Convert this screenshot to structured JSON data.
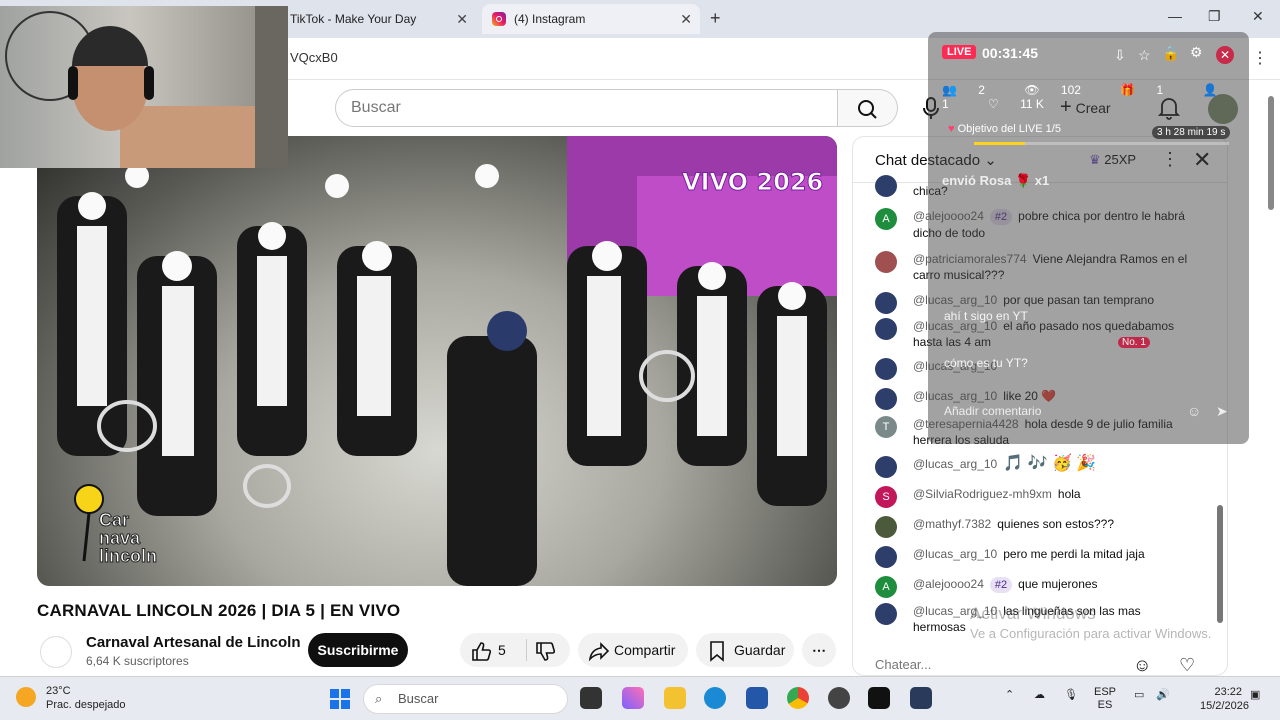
{
  "browser": {
    "tabs": [
      {
        "label": "TikTok - Make Your Day"
      },
      {
        "label": "(4) Instagram"
      }
    ],
    "url_fragment": "VQcxB0"
  },
  "youtube": {
    "search_placeholder": "Buscar",
    "create_label": "Crear",
    "video_overlay_text": "VIVO 2026",
    "logo_text": "Car nava lincoln",
    "title": "CARNAVAL LINCOLN 2026 | DIA 5 | EN VIVO",
    "channel_name": "Carnaval Artesanal de Lincoln",
    "subscribers": "6,64 K suscriptores",
    "subscribe_label": "Suscribirme",
    "like_count": "5",
    "share_label": "Compartir",
    "save_label": "Guardar"
  },
  "chat": {
    "title": "Chat destacado",
    "xp": "25XP",
    "messages": [
      {
        "user": "",
        "text": "chica?",
        "avatar_letter": "",
        "avatar_color": "#2d3e6b"
      },
      {
        "user": "@alejoooo24",
        "badge": "#2",
        "text": "pobre chica por dentro le habrá dicho de todo",
        "avatar_letter": "A",
        "avatar_color": "#1e8e3e"
      },
      {
        "user": "@patriciamorales774",
        "text": "Viene Alejandra Ramos en el carro musical???",
        "avatar_letter": "",
        "avatar_color": "#a05050"
      },
      {
        "user": "@lucas_arg_10",
        "text": "por que pasan tan temprano",
        "avatar_letter": "",
        "avatar_color": "#2d3e6b"
      },
      {
        "user": "@lucas_arg_10",
        "text": "el año pasado nos quedabamos hasta las 4 am",
        "avatar_letter": "",
        "avatar_color": "#2d3e6b"
      },
      {
        "user": "@lucas_arg_10",
        "text": "",
        "avatar_letter": "",
        "avatar_color": "#2d3e6b"
      },
      {
        "user": "@lucas_arg_10",
        "text": "like 20 ❤️",
        "avatar_letter": "",
        "avatar_color": "#2d3e6b"
      },
      {
        "user": "@teresapernia4428",
        "text": "hola desde 9 de julio familia herrera los saluda",
        "avatar_letter": "T",
        "avatar_color": "#7a8a8a"
      },
      {
        "user": "@lucas_arg_10",
        "text": "🎵 🎶 🥳 🎉",
        "avatar_letter": "",
        "avatar_color": "#2d3e6b"
      },
      {
        "user": "@SilviaRodriguez-mh9xm",
        "text": "hola",
        "avatar_letter": "S",
        "avatar_color": "#c2185b"
      },
      {
        "user": "@mathyf.7382",
        "text": "quienes son estos???",
        "avatar_letter": "",
        "avatar_color": "#4a5a3a"
      },
      {
        "user": "@lucas_arg_10",
        "text": "pero me perdi la mitad jaja",
        "avatar_letter": "",
        "avatar_color": "#2d3e6b"
      },
      {
        "user": "@alejoooo24",
        "badge": "#2",
        "text": "que mujerones",
        "avatar_letter": "A",
        "avatar_color": "#1e8e3e"
      },
      {
        "user": "@lucas_arg_10",
        "text": "las lingueñas son las mas hermosas",
        "avatar_letter": "",
        "avatar_color": "#2d3e6b"
      }
    ],
    "input_placeholder": "Chatear..."
  },
  "tiktok_live": {
    "live_label": "LIVE",
    "elapsed": "00:31:45",
    "stats": {
      "people": "2",
      "viewers": "102",
      "gifts": "1",
      "follows": "1",
      "likes": "11 K"
    },
    "goal_label": "Objetivo del LIVE",
    "goal_progress": "1/5",
    "goal_progress_fraction": 0.2,
    "goal_timer": "3 h 28 min 19 s",
    "gift_line": "envió Rosa 🌹 x1",
    "messages": [
      {
        "text": "ahí t sigo en YT"
      },
      {
        "text": "No. 1"
      },
      {
        "text": "cómo es tu YT?"
      }
    ],
    "comment_placeholder": "Añadir comentario"
  },
  "windows": {
    "watermark_title": "Activar Windows",
    "watermark_sub": "Ve a Configuración para activar Windows."
  },
  "taskbar": {
    "temperature": "23°C",
    "weather": "Prac. despejado",
    "search_placeholder": "Buscar",
    "lang_top": "ESP",
    "lang_bottom": "ES",
    "time": "23:22",
    "date": "15/2/2026"
  }
}
